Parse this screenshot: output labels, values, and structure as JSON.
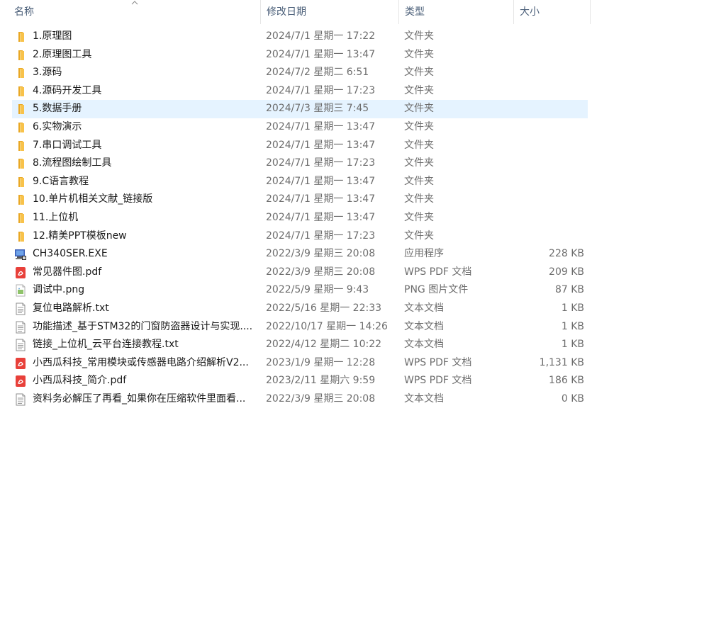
{
  "columns": {
    "name": "名称",
    "date": "修改日期",
    "type": "类型",
    "size": "大小"
  },
  "files": [
    {
      "name": "1.原理图",
      "date": "2024/7/1 星期一 17:22",
      "type": "文件夹",
      "size": "",
      "icon": "folder-icon"
    },
    {
      "name": "2.原理图工具",
      "date": "2024/7/1 星期一 13:47",
      "type": "文件夹",
      "size": "",
      "icon": "folder-icon"
    },
    {
      "name": "3.源码",
      "date": "2024/7/2 星期二 6:51",
      "type": "文件夹",
      "size": "",
      "icon": "folder-icon"
    },
    {
      "name": "4.源码开发工具",
      "date": "2024/7/1 星期一 17:23",
      "type": "文件夹",
      "size": "",
      "icon": "folder-icon"
    },
    {
      "name": "5.数据手册",
      "date": "2024/7/3 星期三 7:45",
      "type": "文件夹",
      "size": "",
      "icon": "folder-icon",
      "selected": true
    },
    {
      "name": "6.实物演示",
      "date": "2024/7/1 星期一 13:47",
      "type": "文件夹",
      "size": "",
      "icon": "folder-icon"
    },
    {
      "name": "7.串口调试工具",
      "date": "2024/7/1 星期一 13:47",
      "type": "文件夹",
      "size": "",
      "icon": "folder-icon"
    },
    {
      "name": "8.流程图绘制工具",
      "date": "2024/7/1 星期一 17:23",
      "type": "文件夹",
      "size": "",
      "icon": "folder-icon"
    },
    {
      "name": "9.C语言教程",
      "date": "2024/7/1 星期一 13:47",
      "type": "文件夹",
      "size": "",
      "icon": "folder-icon"
    },
    {
      "name": "10.单片机相关文献_链接版",
      "date": "2024/7/1 星期一 13:47",
      "type": "文件夹",
      "size": "",
      "icon": "folder-icon"
    },
    {
      "name": "11.上位机",
      "date": "2024/7/1 星期一 13:47",
      "type": "文件夹",
      "size": "",
      "icon": "folder-icon"
    },
    {
      "name": "12.精美PPT模板new",
      "date": "2024/7/1 星期一 17:23",
      "type": "文件夹",
      "size": "",
      "icon": "folder-icon"
    },
    {
      "name": "CH340SER.EXE",
      "date": "2022/3/9 星期三 20:08",
      "type": "应用程序",
      "size": "228 KB",
      "icon": "exe-icon"
    },
    {
      "name": "常见器件图.pdf",
      "date": "2022/3/9 星期三 20:08",
      "type": "WPS PDF 文档",
      "size": "209 KB",
      "icon": "pdf-icon"
    },
    {
      "name": "调试中.png",
      "date": "2022/5/9 星期一 9:43",
      "type": "PNG 图片文件",
      "size": "87 KB",
      "icon": "png-icon"
    },
    {
      "name": "复位电路解析.txt",
      "date": "2022/5/16 星期一 22:33",
      "type": "文本文档",
      "size": "1 KB",
      "icon": "txt-icon"
    },
    {
      "name": "功能描述_基于STM32的门窗防盗器设计与实现....",
      "date": "2022/10/17 星期一 14:26",
      "type": "文本文档",
      "size": "1 KB",
      "icon": "txt-icon"
    },
    {
      "name": "链接_上位机_云平台连接教程.txt",
      "date": "2022/4/12 星期二 10:22",
      "type": "文本文档",
      "size": "1 KB",
      "icon": "txt-icon"
    },
    {
      "name": "小西瓜科技_常用模块或传感器电路介绍解析V2...",
      "date": "2023/1/9 星期一 12:28",
      "type": "WPS PDF 文档",
      "size": "1,131 KB",
      "icon": "pdf-icon"
    },
    {
      "name": "小西瓜科技_简介.pdf",
      "date": "2023/2/11 星期六 9:59",
      "type": "WPS PDF 文档",
      "size": "186 KB",
      "icon": "pdf-icon"
    },
    {
      "name": "资料务必解压了再看_如果你在压缩软件里面看...",
      "date": "2022/3/9 星期三 20:08",
      "type": "文本文档",
      "size": "0 KB",
      "icon": "txt-icon"
    }
  ],
  "colors": {
    "selected_row": "#e5f3ff",
    "folder": "#f8c24a",
    "pdf": "#e8403a",
    "header_text": "#4c607a"
  }
}
